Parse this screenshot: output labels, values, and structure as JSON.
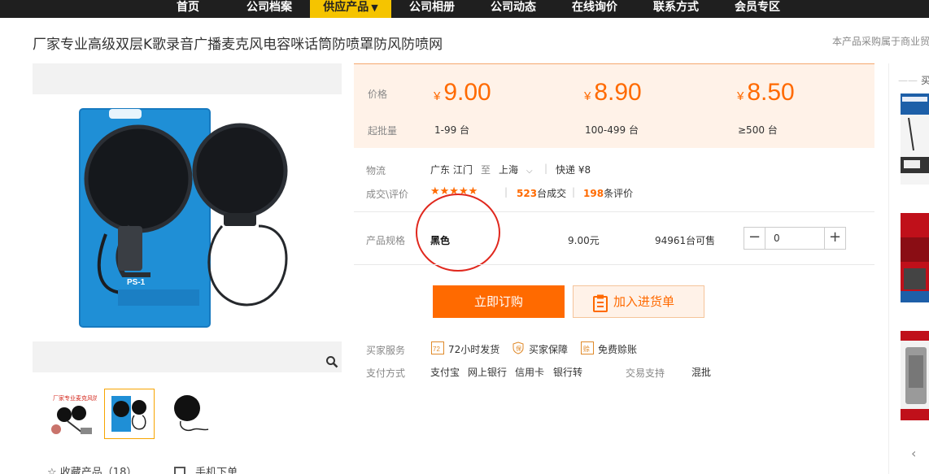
{
  "nav": {
    "items": [
      {
        "label": "首页"
      },
      {
        "label": "公司档案"
      },
      {
        "label": "供应产品",
        "caret": "▼"
      },
      {
        "label": "公司相册"
      },
      {
        "label": "公司动态"
      },
      {
        "label": "在线询价"
      },
      {
        "label": "联系方式"
      },
      {
        "label": "会员专区"
      }
    ]
  },
  "product": {
    "title": "厂家专业高级双层K歌录音广播麦克风电容咪话筒防喷罩防风防喷网",
    "note": "本产品采购属于商业贸"
  },
  "gallery": {
    "main_label": "PS-1",
    "thumb1_text": "厂家专业麦克风防喷罩",
    "favorites": "收藏产品（18）",
    "mobile_order": "手机下单"
  },
  "pricing": {
    "price_label": "价格",
    "moq_label": "起批量",
    "currency": "¥",
    "tiers": [
      {
        "price": "9.00",
        "range": "1-99 台"
      },
      {
        "price": "8.90",
        "range": "100-499 台"
      },
      {
        "price": "8.50",
        "range": "≥500 台"
      }
    ]
  },
  "logistics": {
    "label": "物流",
    "from": "广东 江门",
    "to_word": "至",
    "dest": "上海",
    "express": "快递 ¥8"
  },
  "deals": {
    "label": "成交\\评价",
    "stars": "★★★★★",
    "sold_count": "523",
    "sold_unit": "台成交",
    "review_count": "198",
    "review_unit": "条评价"
  },
  "spec": {
    "label": "产品规格",
    "color": "黑色",
    "price": "9.00元",
    "stock": "94961台可售",
    "quantity": "0",
    "minus": "−",
    "plus": "+"
  },
  "actions": {
    "buy": "立即订购",
    "cart": "加入进货单"
  },
  "services": {
    "label": "买家服务",
    "items": [
      "72小时发货",
      "买家保障",
      "免费赊账"
    ]
  },
  "payment": {
    "label": "支付方式",
    "methods": [
      "支付宝",
      "网上银行",
      "信用卡",
      "银行转"
    ],
    "trade_label": "交易支持",
    "trade_value": "混批"
  },
  "sidebar": {
    "title": "买",
    "arrow": "‹"
  },
  "colors": {
    "accent": "#ff6a00",
    "nav_bg": "#1f1f1f",
    "nav_active": "#f5c400",
    "price_bg": "#fff2e8",
    "circle": "#e0281e"
  }
}
